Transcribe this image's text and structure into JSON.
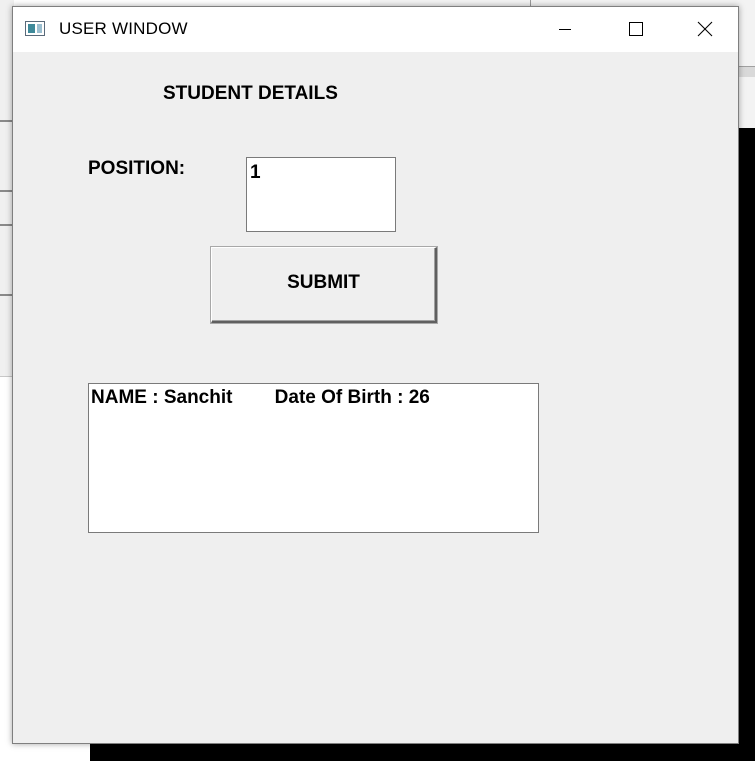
{
  "window": {
    "title": "USER WINDOW",
    "icon": "app-window-icon",
    "controls": {
      "minimize": "minimize-icon",
      "maximize": "maximize-icon",
      "close": "close-icon"
    }
  },
  "form": {
    "heading": "STUDENT DETAILS",
    "position_label": "POSITION:",
    "position_value": "1",
    "submit_label": "SUBMIT",
    "output_text": "NAME : Sanchit        Date Of Birth : 26"
  },
  "colors": {
    "window_bg": "#efefef",
    "titlebar_bg": "#ffffff",
    "field_bg": "#ffffff"
  }
}
